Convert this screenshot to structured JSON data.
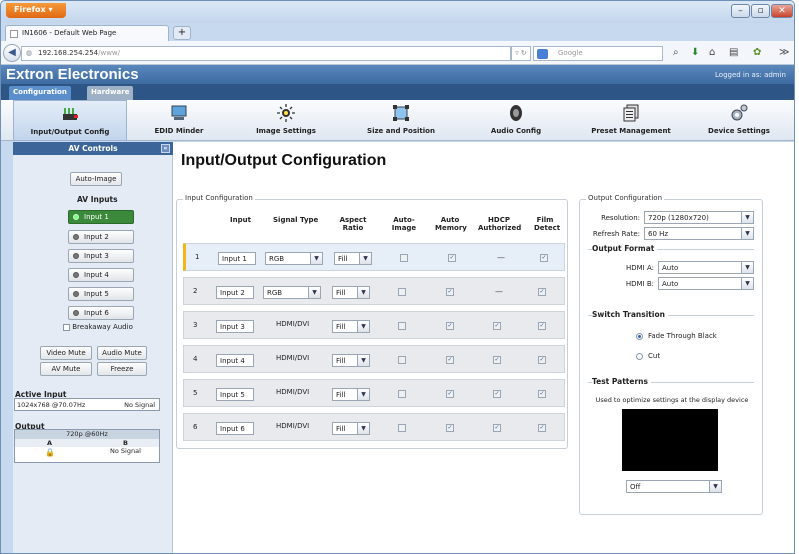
{
  "browser": {
    "menu_button": "Firefox",
    "tab_title": "IN1606 - Default Web Page",
    "new_tab": "+",
    "url_host": "192.168.254.254",
    "url_path": "/www/",
    "search_placeholder": "Google"
  },
  "app": {
    "brand": "Extron Electronics",
    "login_status": "Logged in as: admin",
    "tabs": [
      "Configuration",
      "Hardware"
    ],
    "toolbar": [
      "Input/Output Config",
      "EDID Minder",
      "Image Settings",
      "Size and Position",
      "Audio Config",
      "Preset Management",
      "Device Settings"
    ]
  },
  "sidebar": {
    "title": "AV Controls",
    "auto_image": "Auto-Image",
    "av_inputs_label": "AV Inputs",
    "inputs": [
      "Input 1",
      "Input 2",
      "Input 3",
      "Input 4",
      "Input 5",
      "Input 6"
    ],
    "selected_input": 1,
    "breakaway_audio": "Breakaway Audio",
    "video_mute": "Video Mute",
    "audio_mute": "Audio Mute",
    "av_mute": "AV Mute",
    "freeze": "Freeze",
    "active_input_label": "Active Input",
    "active_input_res": "1024x768 @70.07Hz",
    "active_input_signal": "No Signal",
    "output_label": "Output",
    "output_res": "720p @60Hz",
    "output_a": "A",
    "output_b": "B",
    "output_signal": "No Signal"
  },
  "main": {
    "title": "Input/Output Configuration",
    "input_config_legend": "Input Configuration",
    "columns": {
      "input": "Input",
      "signal_type": "Signal Type",
      "aspect": "Aspect Ratio",
      "auto_image": "Auto-Image",
      "auto_memory": "Auto Memory",
      "hdcp": "HDCP Authorized",
      "film": "Film Detect"
    },
    "rows": [
      {
        "num": "1",
        "name": "Input 1",
        "signal": "RGB",
        "aspect": "Fill",
        "hdcp": "—"
      },
      {
        "num": "2",
        "name": "Input 2",
        "signal": "RGB",
        "aspect": "Fill",
        "hdcp": "—"
      },
      {
        "num": "3",
        "name": "Input 3",
        "signal": "HDMI/DVI",
        "aspect": "Fill"
      },
      {
        "num": "4",
        "name": "Input 4",
        "signal": "HDMI/DVI",
        "aspect": "Fill"
      },
      {
        "num": "5",
        "name": "Input 5",
        "signal": "HDMI/DVI",
        "aspect": "Fill"
      },
      {
        "num": "6",
        "name": "Input 6",
        "signal": "HDMI/DVI",
        "aspect": "Fill"
      }
    ]
  },
  "output": {
    "legend": "Output Configuration",
    "resolution_label": "Resolution:",
    "resolution_value": "720p (1280x720)",
    "refresh_label": "Refresh Rate:",
    "refresh_value": "60 Hz",
    "format_heading": "Output Format",
    "hdmi_a_label": "HDMI A:",
    "hdmi_a_value": "Auto",
    "hdmi_b_label": "HDMI B:",
    "hdmi_b_value": "Auto",
    "switch_heading": "Switch Transition",
    "fade_label": "Fade Through Black",
    "cut_label": "Cut",
    "test_heading": "Test Patterns",
    "test_desc": "Used to optimize settings at the display device",
    "test_value": "Off"
  }
}
